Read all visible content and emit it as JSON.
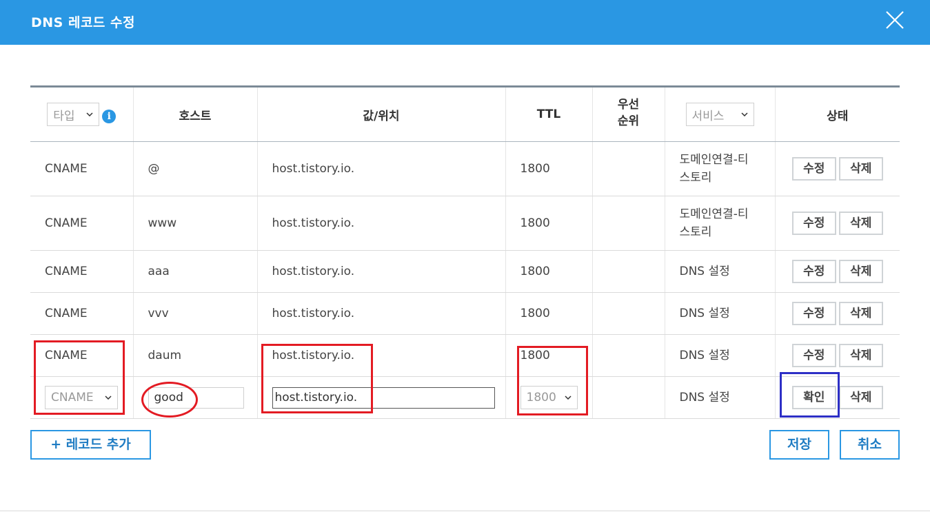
{
  "dialog": {
    "title": "DNS 레코드 수정"
  },
  "header": {
    "type_select": "타입",
    "host": "호스트",
    "value": "값/위치",
    "ttl": "TTL",
    "priority_line1": "우선",
    "priority_line2": "순위",
    "service_select": "서비스",
    "status": "상태"
  },
  "rows": [
    {
      "type": "CNAME",
      "host": "@",
      "value": "host.tistory.io.",
      "ttl": "1800",
      "priority": "",
      "service_line1": "도메인연결-티",
      "service_line2": "스토리",
      "edit": "수정",
      "delete": "삭제"
    },
    {
      "type": "CNAME",
      "host": "www",
      "value": "host.tistory.io.",
      "ttl": "1800",
      "priority": "",
      "service_line1": "도메인연결-티",
      "service_line2": "스토리",
      "edit": "수정",
      "delete": "삭제"
    },
    {
      "type": "CNAME",
      "host": "aaa",
      "value": "host.tistory.io.",
      "ttl": "1800",
      "priority": "",
      "service_line1": "DNS 설정",
      "service_line2": "",
      "edit": "수정",
      "delete": "삭제"
    },
    {
      "type": "CNAME",
      "host": "vvv",
      "value": "host.tistory.io.",
      "ttl": "1800",
      "priority": "",
      "service_line1": "DNS 설정",
      "service_line2": "",
      "edit": "수정",
      "delete": "삭제"
    },
    {
      "type": "CNAME",
      "host": "daum",
      "value": "host.tistory.io.",
      "ttl": "1800",
      "priority": "",
      "service_line1": "DNS 설정",
      "service_line2": "",
      "edit": "수정",
      "delete": "삭제"
    }
  ],
  "edit_row": {
    "type_value": "CNAME",
    "host_value": "good",
    "value_value": "host.tistory.io.",
    "ttl_value": "1800",
    "service": "DNS 설정",
    "confirm": "확인",
    "delete": "삭제"
  },
  "footer": {
    "add_record": "+ 레코드 추가",
    "save": "저장",
    "cancel": "취소"
  },
  "colors": {
    "header_bg": "#2a97e3",
    "red_annotation": "#e31b23",
    "blue_annotation": "#2d2fc6"
  }
}
